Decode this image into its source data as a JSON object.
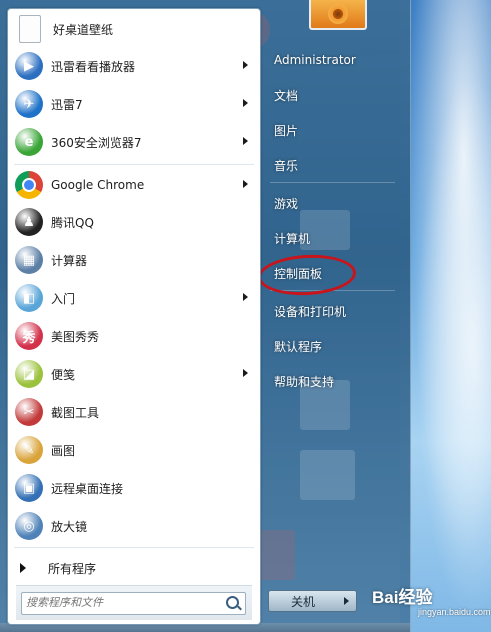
{
  "left_programs": [
    {
      "label": "好桌道壁纸",
      "icon": "document-icon",
      "has_submenu": false,
      "color": "#f0f0f0"
    },
    {
      "label": "迅雷看看播放器",
      "icon": "xunlei-kankan-icon",
      "has_submenu": true,
      "color": "#2c6fc1"
    },
    {
      "label": "迅雷7",
      "icon": "xunlei-bird-icon",
      "has_submenu": true,
      "color": "#1f72c8"
    },
    {
      "label": "360安全浏览器7",
      "icon": "360-browser-icon",
      "has_submenu": true,
      "color": "#3aa537"
    },
    {
      "label": "Google Chrome",
      "icon": "chrome-icon",
      "has_submenu": true,
      "color": "#dd4b39"
    },
    {
      "label": "腾讯QQ",
      "icon": "qq-penguin-icon",
      "has_submenu": false,
      "color": "#222222"
    },
    {
      "label": "计算器",
      "icon": "calculator-icon",
      "has_submenu": false,
      "color": "#5c7fa6"
    },
    {
      "label": "入门",
      "icon": "getting-started-icon",
      "has_submenu": true,
      "color": "#5aa5d8"
    },
    {
      "label": "美图秀秀",
      "icon": "meitu-xiuxiu-icon",
      "has_submenu": false,
      "color": "#d3304a"
    },
    {
      "label": "便笺",
      "icon": "sticky-notes-icon",
      "has_submenu": true,
      "color": "#9bc23c"
    },
    {
      "label": "截图工具",
      "icon": "snipping-tool-icon",
      "has_submenu": false,
      "color": "#c23a3a"
    },
    {
      "label": "画图",
      "icon": "paint-icon",
      "has_submenu": false,
      "color": "#d9a43a"
    },
    {
      "label": "远程桌面连接",
      "icon": "remote-desktop-icon",
      "has_submenu": false,
      "color": "#3470b5"
    },
    {
      "label": "放大镜",
      "icon": "magnifier-icon",
      "has_submenu": false,
      "color": "#4f82b8"
    }
  ],
  "all_programs_label": "所有程序",
  "search": {
    "placeholder": "搜索程序和文件"
  },
  "user_name": "Administrator",
  "right_items": [
    {
      "label": "文档",
      "name": "documents"
    },
    {
      "label": "图片",
      "name": "pictures"
    },
    {
      "label": "音乐",
      "name": "music"
    },
    {
      "label": "游戏",
      "name": "games"
    },
    {
      "label": "计算机",
      "name": "computer"
    },
    {
      "label": "控制面板",
      "name": "control-panel",
      "highlighted": true
    },
    {
      "label": "设备和打印机",
      "name": "devices-printers"
    },
    {
      "label": "默认程序",
      "name": "default-programs"
    },
    {
      "label": "帮助和支持",
      "name": "help-support"
    }
  ],
  "shutdown_label": "关机",
  "watermark": {
    "main": "Bai经验",
    "sub": "jingyan.baidu.com"
  },
  "accent_highlight_color": "#c8141b"
}
